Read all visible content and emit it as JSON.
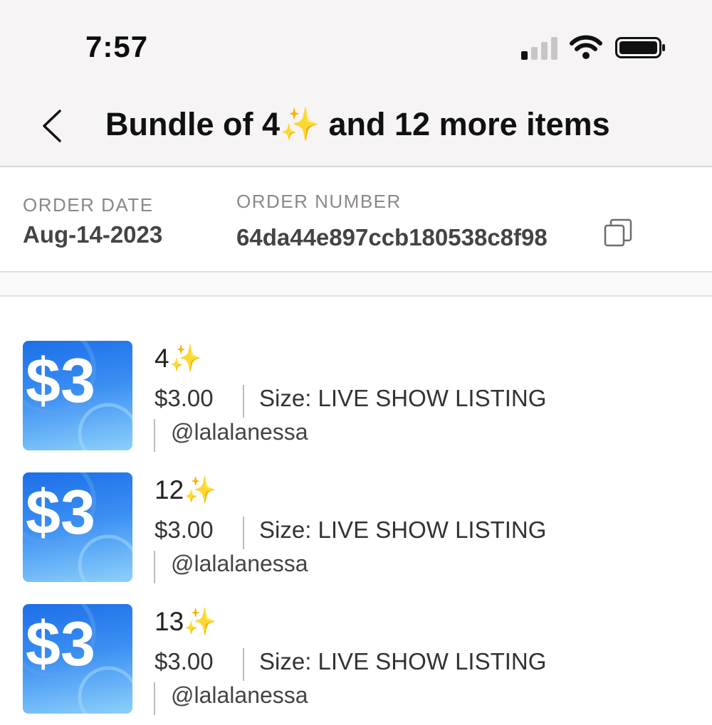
{
  "status_bar": {
    "time": "7:57"
  },
  "header": {
    "title": "Bundle of 4✨ and 12 more items",
    "back_icon": "chevron-left-icon"
  },
  "order": {
    "date_label": "ORDER DATE",
    "date_value": "Aug-14-2023",
    "number_label": "ORDER NUMBER",
    "number_value": "64da44e897ccb180538c8f98",
    "copy_icon": "copy-icon"
  },
  "items": [
    {
      "title": "4✨",
      "price": "$3.00",
      "size": "Size: LIVE SHOW LISTING",
      "seller": "@lalalanessa",
      "thumb_text": "$3"
    },
    {
      "title": "12✨",
      "price": "$3.00",
      "size": "Size: LIVE SHOW LISTING",
      "seller": "@lalalanessa",
      "thumb_text": "$3"
    },
    {
      "title": "13✨",
      "price": "$3.00",
      "size": "Size: LIVE SHOW LISTING",
      "seller": "@lalalanessa",
      "thumb_text": "$3"
    }
  ],
  "colors": {
    "header_bg": "#f6f4f4",
    "thumb_blue": "#1d6fe8",
    "label_gray": "#8c8886"
  }
}
